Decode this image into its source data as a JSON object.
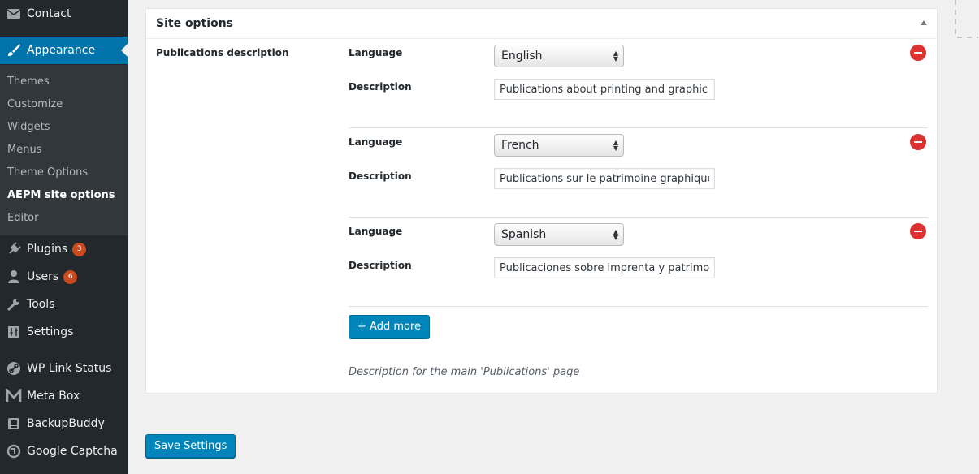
{
  "sidebar": {
    "items_top": [
      {
        "label": "Contact",
        "icon": "mail-icon"
      },
      {
        "label": "Appearance",
        "icon": "paintbrush-icon"
      }
    ],
    "submenu": [
      "Themes",
      "Customize",
      "Widgets",
      "Menus",
      "Theme Options",
      "AEPM site options",
      "Editor"
    ],
    "items_bottom": [
      {
        "label": "Plugins",
        "icon": "plugin-icon",
        "badge": "3"
      },
      {
        "label": "Users",
        "icon": "user-icon",
        "badge": "6"
      },
      {
        "label": "Tools",
        "icon": "wrench-icon"
      },
      {
        "label": "Settings",
        "icon": "settings-icon"
      },
      {
        "label": "WP Link Status",
        "icon": "link-icon"
      },
      {
        "label": "Meta Box",
        "icon": "metabox-icon"
      },
      {
        "label": "BackupBuddy",
        "icon": "backup-icon"
      },
      {
        "label": "Google Captcha",
        "icon": "captcha-icon"
      }
    ],
    "active_color": "#0073aa"
  },
  "panel": {
    "title": "Site options",
    "field_label": "Publications description",
    "groups": [
      {
        "language_label": "Language",
        "language_value": "English",
        "description_label": "Description",
        "description_value": "Publications about printing and graphic heritage"
      },
      {
        "language_label": "Language",
        "language_value": "French",
        "description_label": "Description",
        "description_value": "Publications sur le patrimoine graphique"
      },
      {
        "language_label": "Language",
        "language_value": "Spanish",
        "description_label": "Description",
        "description_value": "Publicaciones sobre imprenta y patrimonio"
      }
    ],
    "add_more_label": "+ Add more",
    "field_description": "Description for the main 'Publications' page"
  },
  "save_label": "Save Settings",
  "colors": {
    "primary_button": "#0085ba",
    "remove_button": "#dc3232",
    "sidebar_bg": "#23282d"
  }
}
